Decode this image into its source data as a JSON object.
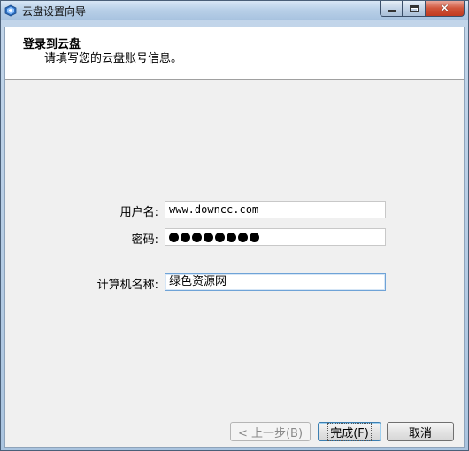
{
  "window": {
    "title": "云盘设置向导",
    "close_symbol": "×"
  },
  "header": {
    "title": "登录到云盘",
    "subtitle": "请填写您的云盘账号信息。"
  },
  "form": {
    "username_label": "用户名:",
    "username_value": "www.downcc.com",
    "password_label": "密码:",
    "password_length": 8,
    "computer_label": "计算机名称:",
    "computer_value": "绿色资源网"
  },
  "buttons": {
    "back": "< 上一步(B)",
    "finish": "完成(F)",
    "cancel": "取消"
  },
  "icons": {
    "app": "cloud-app-icon",
    "minimize": "minimize-icon",
    "maximize": "maximize-icon",
    "close": "close-icon"
  },
  "colors": {
    "titlebar": "#b9d0e8",
    "close_button": "#c03a20",
    "client_bg": "#f0f0f0",
    "header_bg": "#ffffff"
  }
}
